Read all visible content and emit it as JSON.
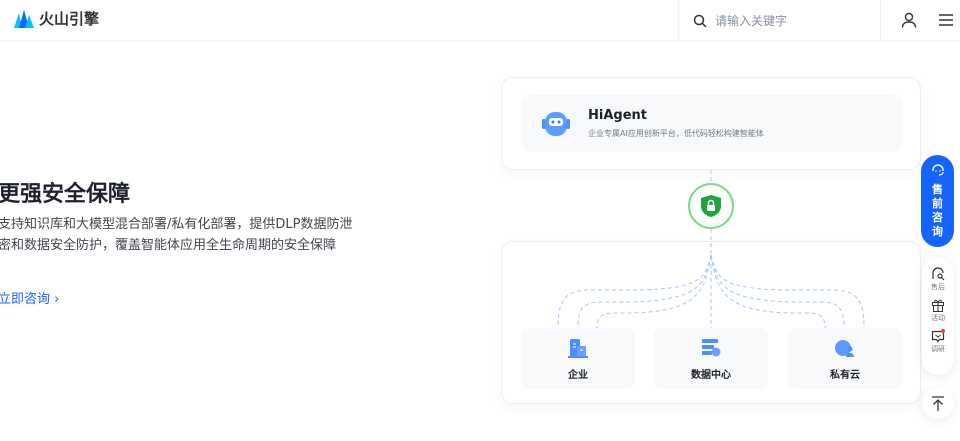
{
  "header": {
    "logo_text": "火山引擎",
    "search_placeholder": "请输入关键字"
  },
  "hero": {
    "title": "更强安全保障",
    "desc_lines": [
      "支持知识库和大模型混合部署/私有化部署，提供DLP数据防泄",
      "密和数据安全防护，覆盖智能体应用全生命周期的安全保障"
    ],
    "link": "立即咨询"
  },
  "diagram": {
    "agent_title": "HiAgent",
    "agent_sub": "企业专属AI应用创新平台，低代码轻松构建智能体",
    "targets": [
      "企业",
      "数据中心",
      "私有云"
    ]
  },
  "float": {
    "consult": [
      "售",
      "前",
      "咨",
      "询"
    ],
    "items": [
      "售后",
      "活动",
      "调研"
    ]
  },
  "colors": {
    "accent": "#1664ff",
    "shield": "#1ea63a"
  }
}
